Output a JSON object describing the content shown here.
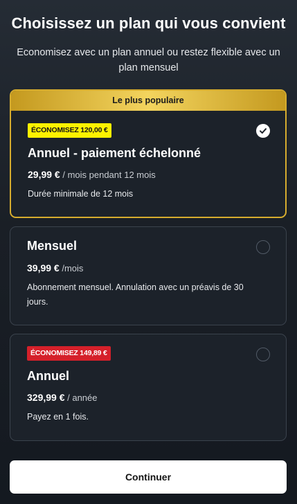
{
  "header": {
    "title": "Choisissez un plan qui vous convient",
    "subtitle": "Economisez avec un plan annuel ou restez flexible avec un plan mensuel"
  },
  "plans": [
    {
      "banner": "Le plus populaire",
      "badge": "ÉCONOMISEZ 120,00 €",
      "badge_color": "#fff200",
      "name": "Annuel - paiement échelonné",
      "price": "29,99 €",
      "price_suffix": "/ mois pendant 12 mois",
      "description": "Durée minimale de 12 mois",
      "selected": true
    },
    {
      "name": "Mensuel",
      "price": "39,99 €",
      "price_suffix": "/mois",
      "description": "Abonnement mensuel. Annulation avec un préavis de 30 jours.",
      "selected": false
    },
    {
      "badge": "ÉCONOMISEZ 149,89 €",
      "badge_color": "#d5202a",
      "name": "Annuel",
      "price": "329,99 €",
      "price_suffix": "/ année",
      "description": "Payez en 1 fois.",
      "selected": false
    }
  ],
  "actions": {
    "continue_label": "Continuer"
  },
  "colors": {
    "accent_gold": "#d6ac2e",
    "background": "#1a1f26"
  },
  "icons": {
    "selected": "checkmark-icon",
    "unselected": "radio-empty-icon"
  }
}
